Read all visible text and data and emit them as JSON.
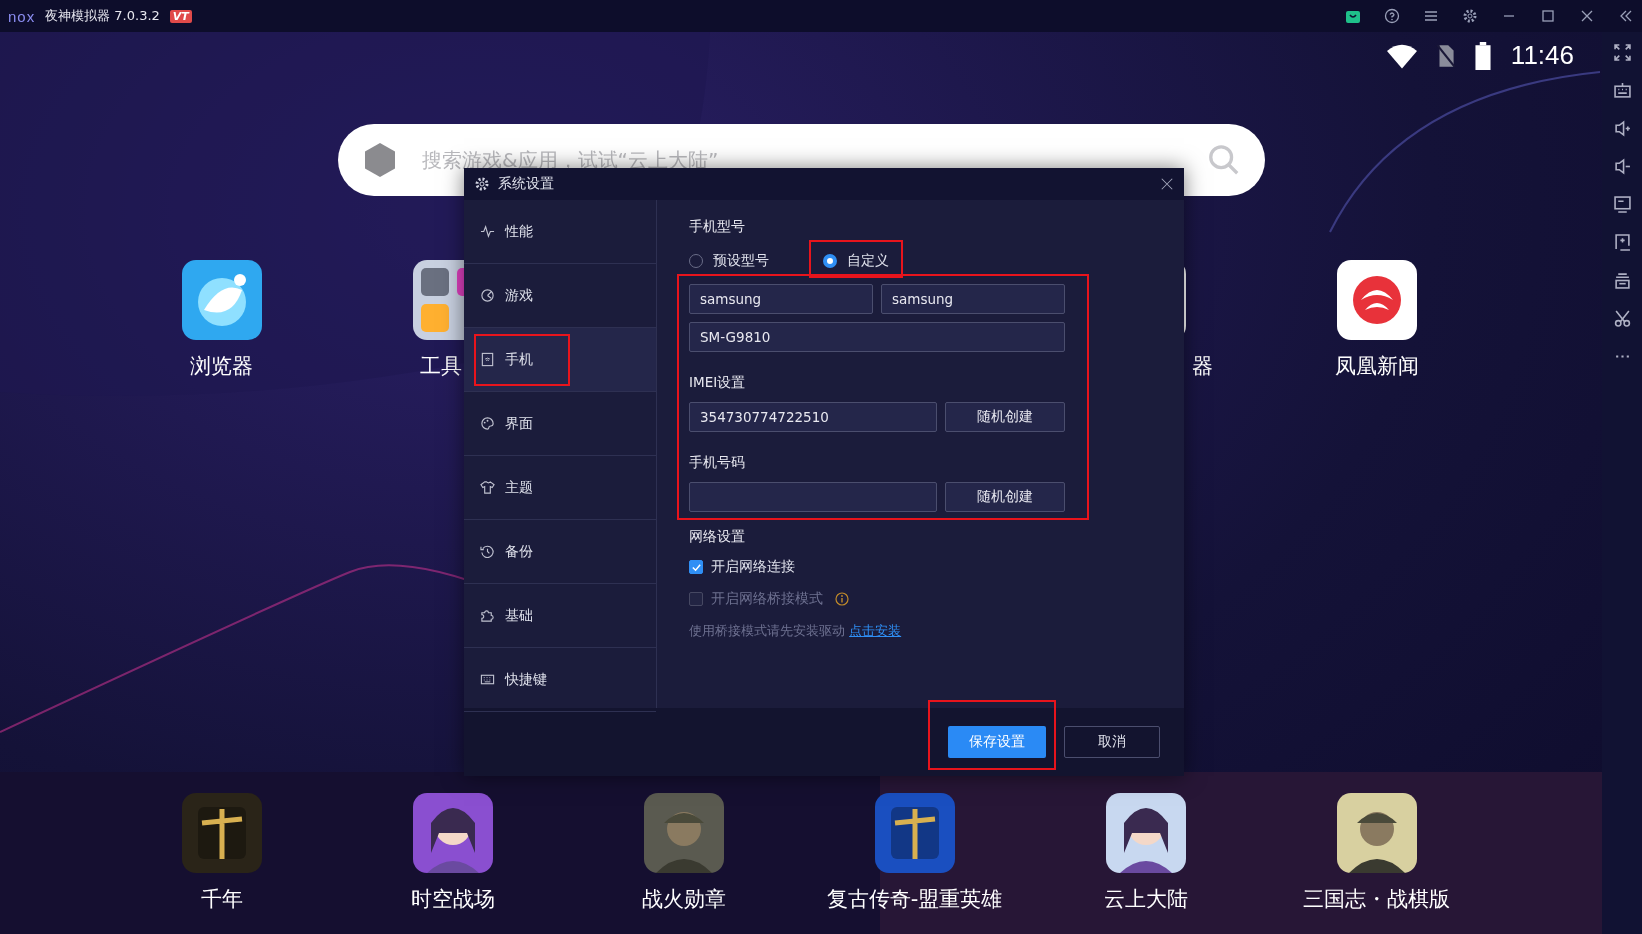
{
  "window": {
    "logo": "nox",
    "title": "夜神模拟器 7.0.3.2",
    "badge": "VT"
  },
  "status_bar": {
    "time": "11:46"
  },
  "search": {
    "placeholder": "搜索游戏&应用，试试“云上大陆”"
  },
  "top_apps": [
    {
      "label": "浏览器",
      "kind": "browser"
    },
    {
      "label": "工具",
      "kind": "cut_right"
    },
    {
      "kind": "hidden"
    },
    {
      "kind": "hidden"
    },
    {
      "label": "器",
      "kind": "cut_left"
    },
    {
      "label": "凤凰新闻",
      "kind": "news"
    }
  ],
  "dialog": {
    "title": "系统设置",
    "nav": [
      {
        "label": "性能",
        "selected": false
      },
      {
        "label": "游戏",
        "selected": false
      },
      {
        "label": "手机",
        "selected": true
      },
      {
        "label": "界面",
        "selected": false
      },
      {
        "label": "主题",
        "selected": false
      },
      {
        "label": "备份",
        "selected": false
      },
      {
        "label": "基础",
        "selected": false
      },
      {
        "label": "快捷键",
        "selected": false
      }
    ],
    "model_heading": "手机型号",
    "model_options": [
      {
        "label": "预设型号",
        "selected": false
      },
      {
        "label": "自定义",
        "selected": true
      }
    ],
    "brand": "samsung",
    "manufacturer": "samsung",
    "model": "SM-G9810",
    "imei_heading": "IMEI设置",
    "imei": "354730774722510",
    "imei_button": "随机创建",
    "phone_heading": "手机号码",
    "phone_button": "随机创建",
    "network_heading": "网络设置",
    "network_options": [
      {
        "label": "开启网络连接",
        "checked": true,
        "disabled": false,
        "info": false
      },
      {
        "label": "开启网络桥接模式",
        "checked": false,
        "disabled": true,
        "info": true
      }
    ],
    "bridge_note": "使用桥接模式请先安装驱动",
    "bridge_link": "点击安装",
    "save": "保存设置",
    "cancel": "取消"
  },
  "dock_apps": [
    {
      "label": "千年"
    },
    {
      "label": "时空战场"
    },
    {
      "label": "战火勋章"
    },
    {
      "label": "复古传奇-盟重英雄"
    },
    {
      "label": "云上大陆"
    },
    {
      "label": "三国志・战棋版"
    }
  ]
}
